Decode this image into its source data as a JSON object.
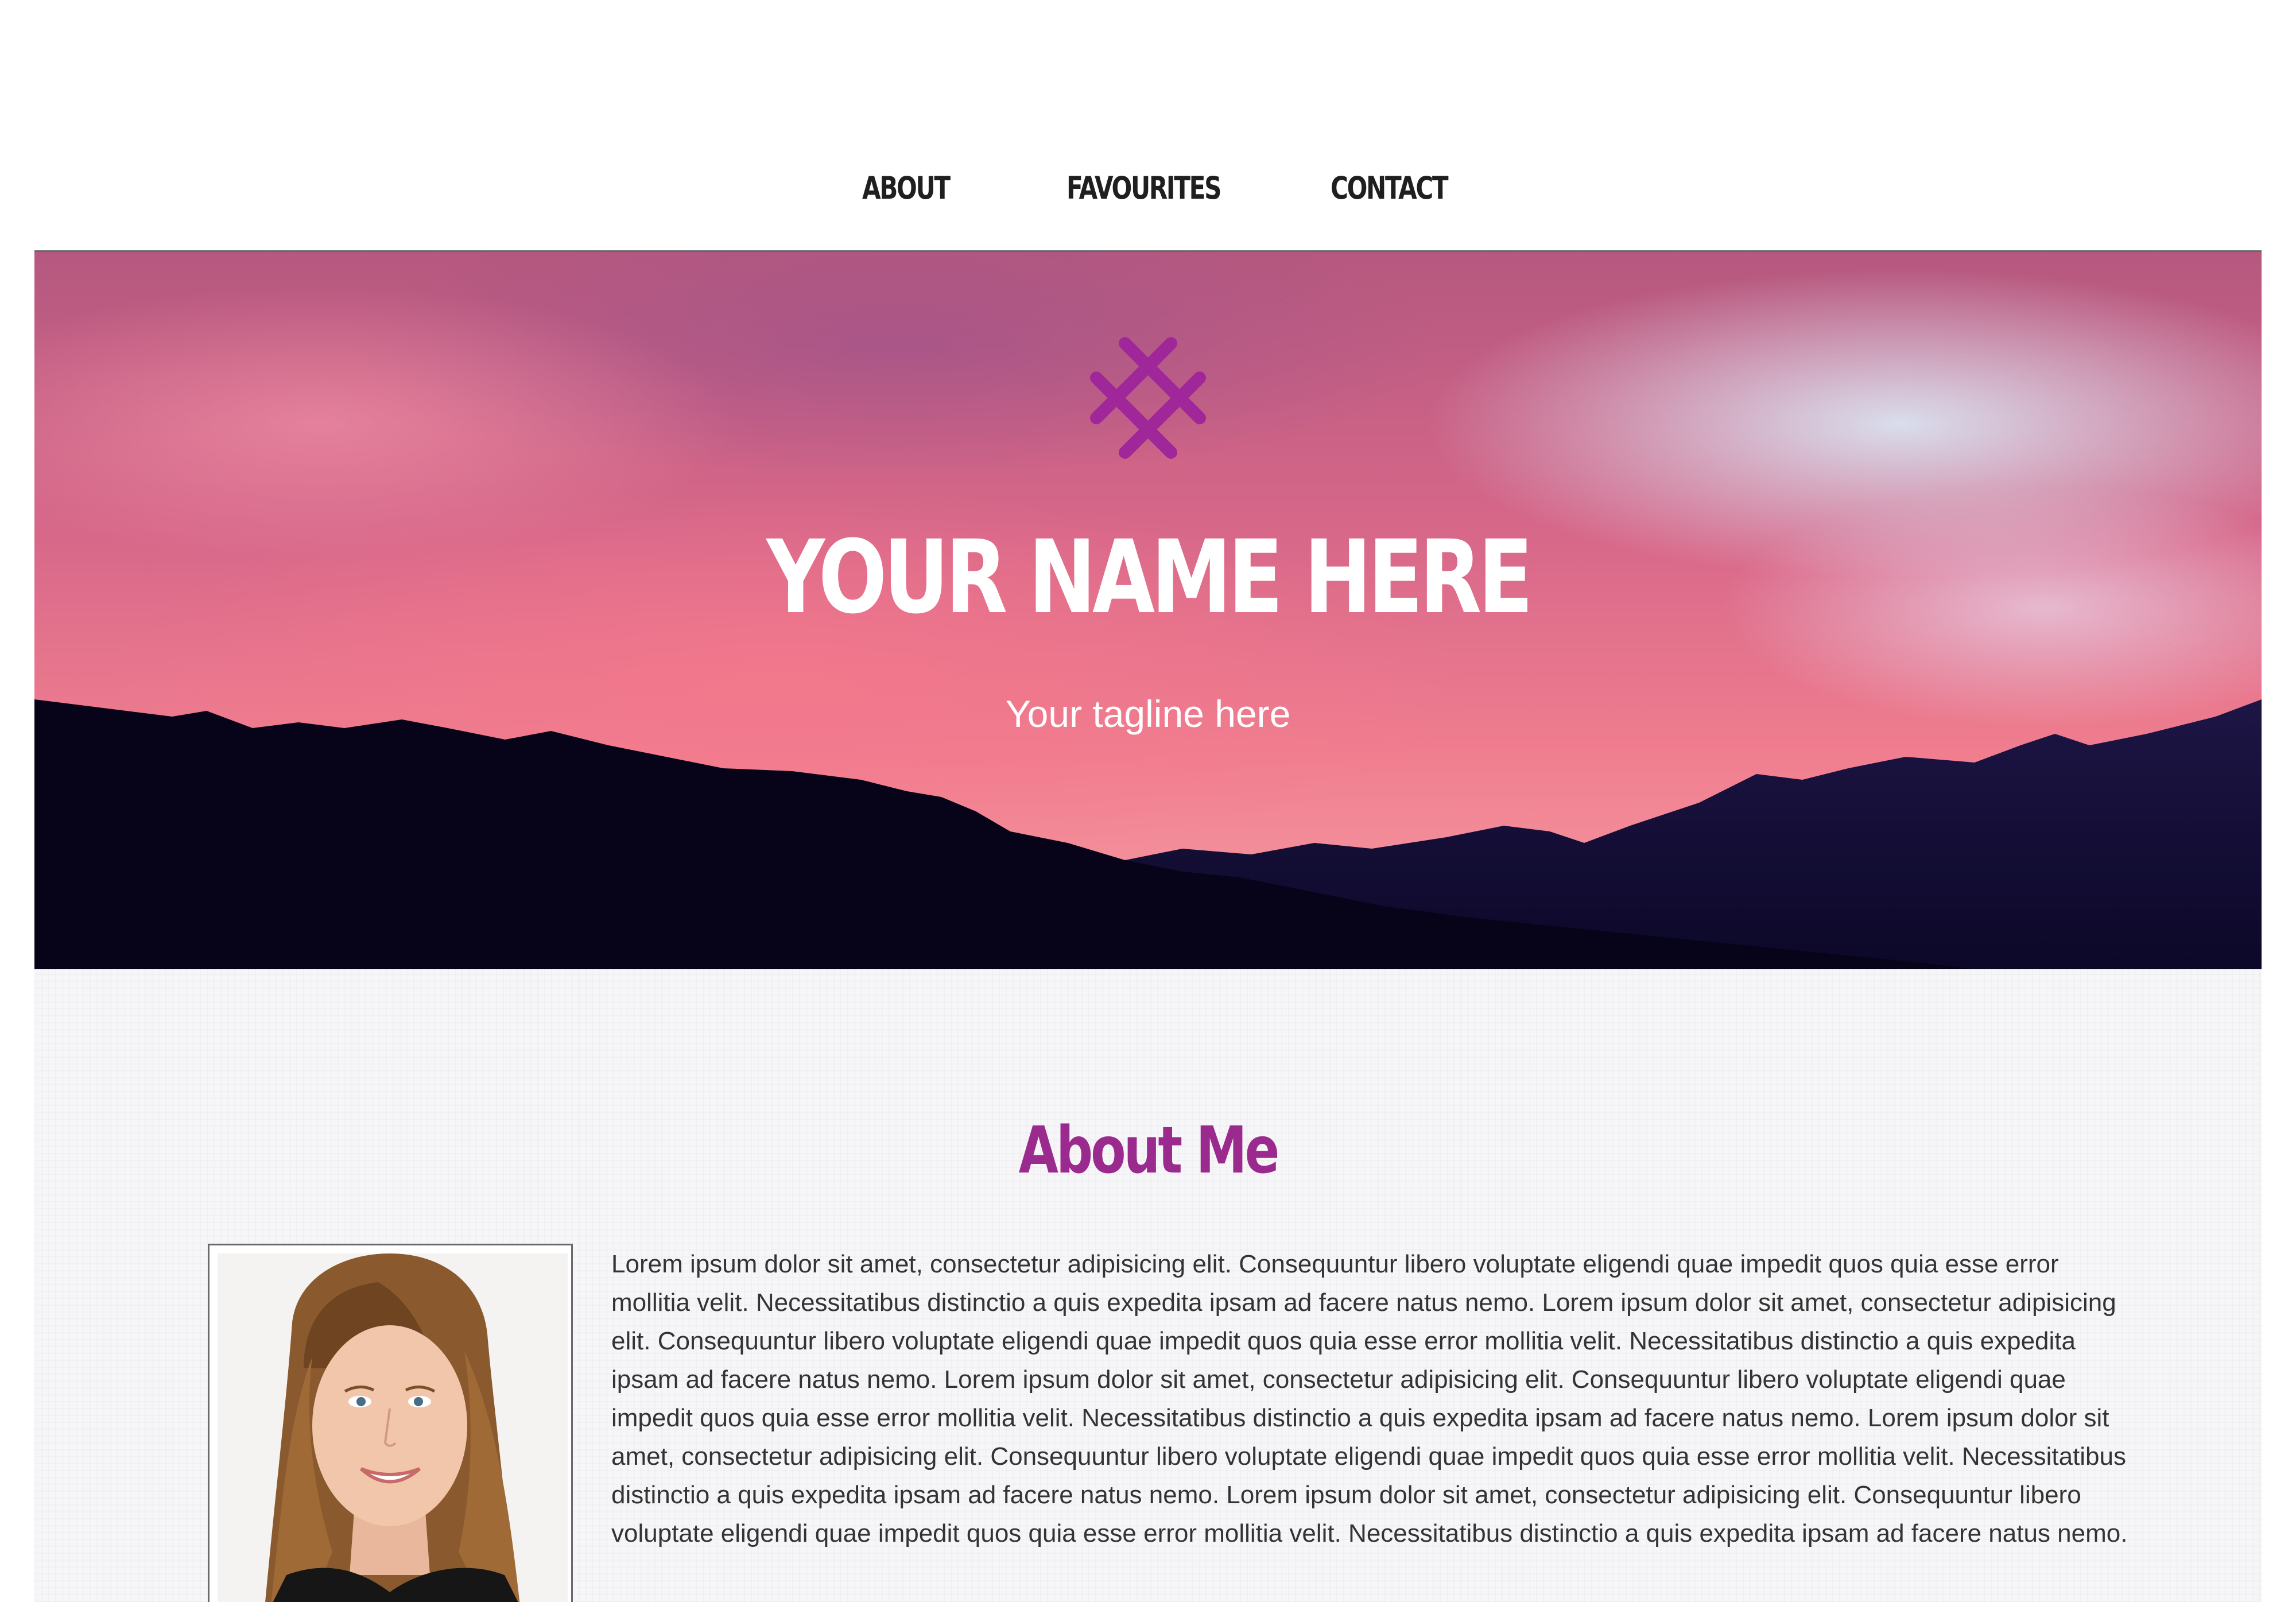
{
  "nav": {
    "items": [
      {
        "label": "ABOUT"
      },
      {
        "label": "FAVOURITES"
      },
      {
        "label": "CONTACT"
      }
    ]
  },
  "hero": {
    "logo_icon": "pink-cross-hatch-logo-icon",
    "title": "YOUR NAME HERE",
    "tagline": "Your tagline here"
  },
  "about": {
    "heading": "About Me",
    "body": "Lorem ipsum dolor sit amet, consectetur adipisicing elit. Consequuntur libero voluptate eligendi quae impedit quos quia esse error mollitia velit. Necessitatibus distinctio a quis expedita ipsam ad facere natus nemo. Lorem ipsum dolor sit amet, consectetur adipisicing elit. Consequuntur libero voluptate eligendi quae impedit quos quia esse error mollitia velit. Necessitatibus distinctio a quis expedita ipsam ad facere natus nemo. Lorem ipsum dolor sit amet, consectetur adipisicing elit. Consequuntur libero voluptate eligendi quae impedit quos quia esse error mollitia velit. Necessitatibus distinctio a quis expedita ipsam ad facere natus nemo. Lorem ipsum dolor sit amet, consectetur adipisicing elit. Consequuntur libero voluptate eligendi quae impedit quos quia esse error mollitia velit. Necessitatibus distinctio a quis expedita ipsam ad facere natus nemo. Lorem ipsum dolor sit amet, consectetur adipisicing elit. Consequuntur libero voluptate eligendi quae impedit quos quia esse error mollitia velit. Necessitatibus distinctio a quis expedita ipsam ad facere natus nemo.",
    "photo": "profile-photo"
  },
  "colors": {
    "accent": "#9b2a8e",
    "nav_text": "#1f1f1f",
    "hero_text": "#ffffff",
    "body_text": "#333333",
    "mountain": "#0a0620"
  }
}
